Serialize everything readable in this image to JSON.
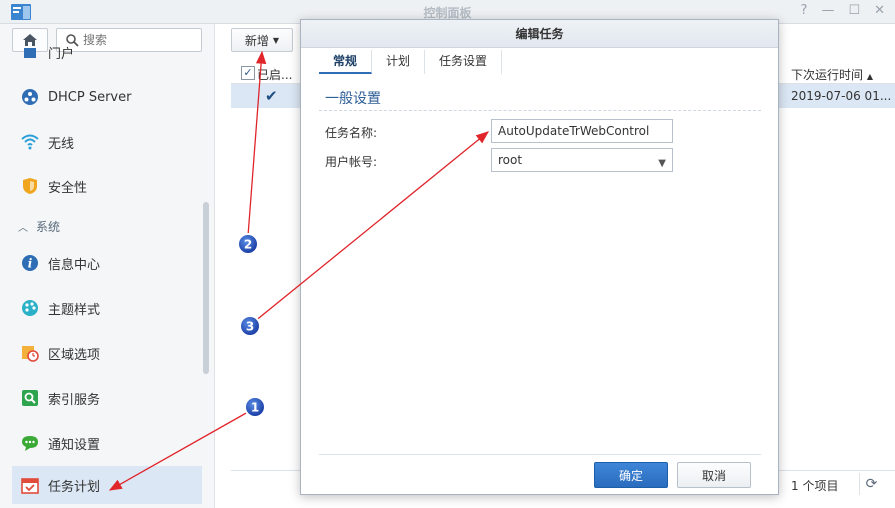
{
  "window": {
    "title": "控制面板"
  },
  "sidebar": {
    "search_placeholder": "搜索",
    "items": [
      {
        "label": "门户",
        "icon": "portal-icon"
      },
      {
        "label": "DHCP Server",
        "icon": "dhcp-server-icon"
      },
      {
        "label": "无线",
        "icon": "wifi-icon"
      },
      {
        "label": "安全性",
        "icon": "shield-icon"
      },
      {
        "label": "信息中心",
        "icon": "info-icon"
      },
      {
        "label": "主题样式",
        "icon": "palette-icon"
      },
      {
        "label": "区域选项",
        "icon": "region-clock-icon"
      },
      {
        "label": "索引服务",
        "icon": "index-search-icon"
      },
      {
        "label": "通知设置",
        "icon": "chat-bubble-icon"
      },
      {
        "label": "任务计划",
        "icon": "calendar-icon"
      }
    ],
    "section_label": "系统"
  },
  "main": {
    "add_button": "新增",
    "columns": {
      "enabled": "已启...",
      "next_run": "下次运行时间"
    },
    "row": {
      "next_run": "2019-07-06 01..."
    },
    "footer_count": "1 个项目"
  },
  "dialog": {
    "title": "编辑任务",
    "tabs": [
      "常规",
      "计划",
      "任务设置"
    ],
    "section": "一般设置",
    "task_name_label": "任务名称:",
    "task_name_value": "AutoUpdateTrWebControl",
    "user_label": "用户帐号:",
    "user_value": "root",
    "ok_button": "确定",
    "cancel_button": "取消"
  },
  "annotations": [
    "1",
    "2",
    "3"
  ],
  "colors": {
    "accent": "#2f6db5",
    "selection": "#dbe7f4",
    "arrow": "#e0252b"
  }
}
